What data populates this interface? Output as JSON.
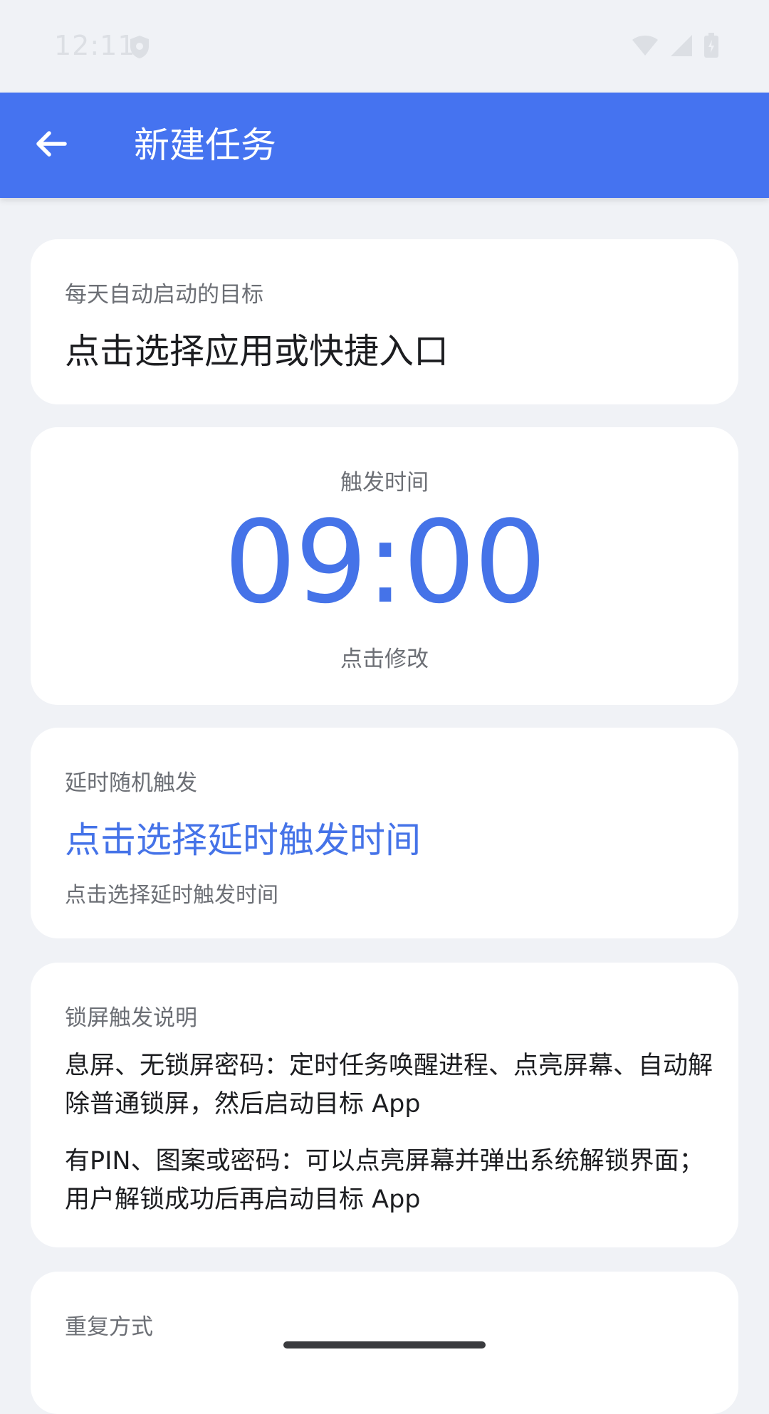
{
  "status_bar": {
    "time": "12:11",
    "icons": [
      "shield-icon",
      "wifi-icon",
      "signal-icon",
      "battery-icon"
    ]
  },
  "app_bar": {
    "back_icon": "arrow-left-icon",
    "title": "新建任务",
    "background_color": "#4573f0"
  },
  "target_card": {
    "label": "每天自动启动的目标",
    "value": "点击选择应用或快捷入口"
  },
  "trigger_time_card": {
    "label": "触发时间",
    "time": "09:00",
    "hint": "点击修改",
    "accent_color": "#4573e8"
  },
  "delay_card": {
    "label": "延时随机触发",
    "value": "点击选择延时触发时间",
    "hint": "点击选择延时触发时间"
  },
  "lockscreen_card": {
    "label": "锁屏触发说明",
    "paragraph1": "息屏、无锁屏密码：定时任务唤醒进程、点亮屏幕、自动解除普通锁屏，然后启动目标 App",
    "paragraph2": "有PIN、图案或密码：可以点亮屏幕并弹出系统解锁界面；用户解锁成功后再启动目标 App"
  },
  "repeat_card": {
    "label": "重复方式"
  }
}
